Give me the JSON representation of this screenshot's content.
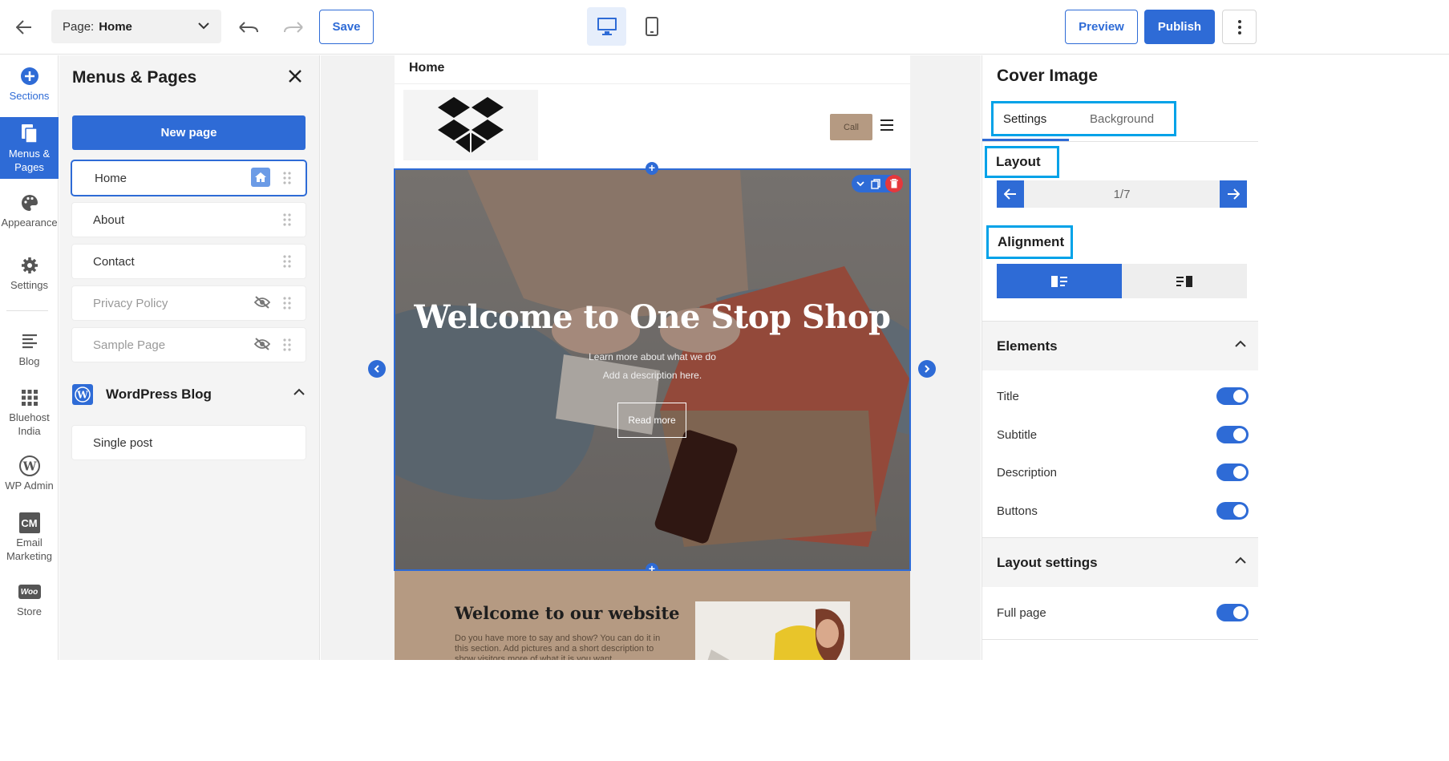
{
  "topbar": {
    "page_label": "Page:",
    "page_value": "Home",
    "save": "Save",
    "preview": "Preview",
    "publish": "Publish"
  },
  "rail": {
    "sections": "Sections",
    "menus_line1": "Menus &",
    "menus_line2": "Pages",
    "appearance": "Appearance",
    "settings": "Settings",
    "blog": "Blog",
    "bluehost_line1": "Bluehost",
    "bluehost_line2": "India",
    "wpadmin": "WP Admin",
    "email_badge": "CM",
    "email_line1": "Email",
    "email_line2": "Marketing",
    "store_badge": "Woo",
    "store": "Store"
  },
  "menus_panel": {
    "title": "Menus & Pages",
    "new_page": "New page",
    "pages": [
      {
        "label": "Home"
      },
      {
        "label": "About"
      },
      {
        "label": "Contact"
      },
      {
        "label": "Privacy Policy"
      },
      {
        "label": "Sample Page"
      }
    ],
    "wp_blog_title": "WordPress Blog",
    "wp_blog_items": [
      {
        "label": "Single post"
      }
    ]
  },
  "canvas": {
    "page_name": "Home",
    "call_button": "Call",
    "hero_title": "Welcome to One Stop Shop",
    "hero_subtitle": "Learn more about what we do",
    "hero_description": "Add a description here.",
    "hero_button": "Read more",
    "welcome_title": "Welcome to our website",
    "welcome_text": "Do you have more to say and show? You can do it in this section. Add pictures and a short description to show visitors more of what it is you want"
  },
  "right_panel": {
    "title": "Cover Image",
    "tabs": {
      "settings": "Settings",
      "background": "Background"
    },
    "layout_label": "Layout",
    "layout_value": "1/7",
    "alignment_label": "Alignment",
    "elements_title": "Elements",
    "elements": [
      {
        "label": "Title",
        "on": true
      },
      {
        "label": "Subtitle",
        "on": true
      },
      {
        "label": "Description",
        "on": true
      },
      {
        "label": "Buttons",
        "on": true
      }
    ],
    "layout_settings_title": "Layout settings",
    "full_page_label": "Full page",
    "full_page_on": true
  },
  "colors": {
    "accent": "#2e6bd6",
    "highlight": "#00a2e8",
    "call_button": "#b59a82",
    "delete": "#e5383b"
  },
  "icons": [
    "arrow-left-icon",
    "chevron-down-icon",
    "undo-icon",
    "redo-icon",
    "desktop-icon",
    "mobile-icon",
    "more-vertical-icon",
    "plus-circle-icon",
    "pages-icon",
    "palette-icon",
    "gear-icon",
    "blog-icon",
    "grid-icon",
    "wordpress-icon",
    "close-icon",
    "home-icon",
    "drag-handle-icon",
    "eye-off-icon",
    "chevron-up-icon",
    "hamburger-icon",
    "copy-icon",
    "trash-icon",
    "chevron-left-icon",
    "chevron-right-icon",
    "align-left-icon",
    "align-right-icon"
  ]
}
